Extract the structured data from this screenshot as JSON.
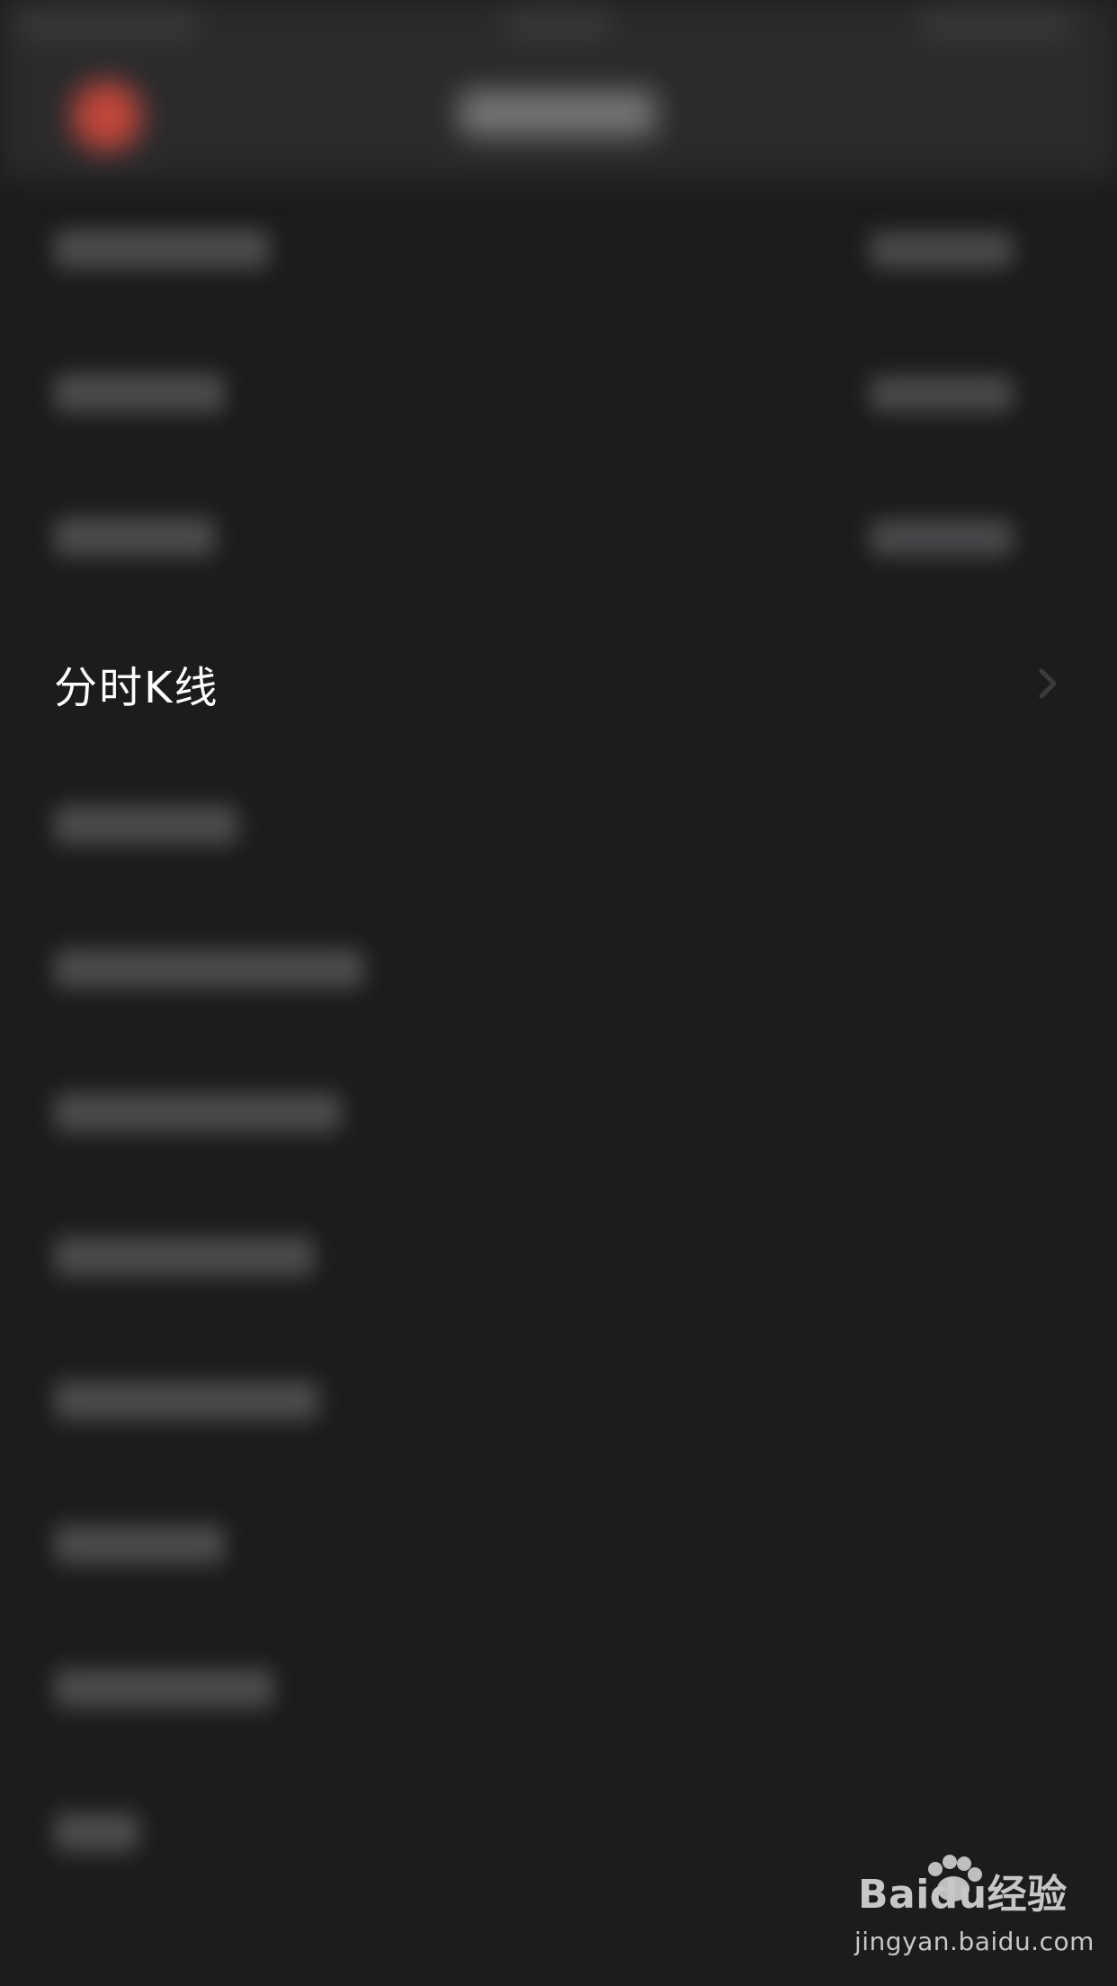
{
  "screen": {
    "background_color": "#1c1c1e"
  },
  "top_bar": {
    "back_icon": "back-icon-red",
    "accent_color": "#c2473b"
  },
  "rows": [
    {
      "label": "分时K线"
    }
  ],
  "watermark": {
    "brand_text": "Baidu经验",
    "url_text": "jingyan.baidu.com"
  }
}
